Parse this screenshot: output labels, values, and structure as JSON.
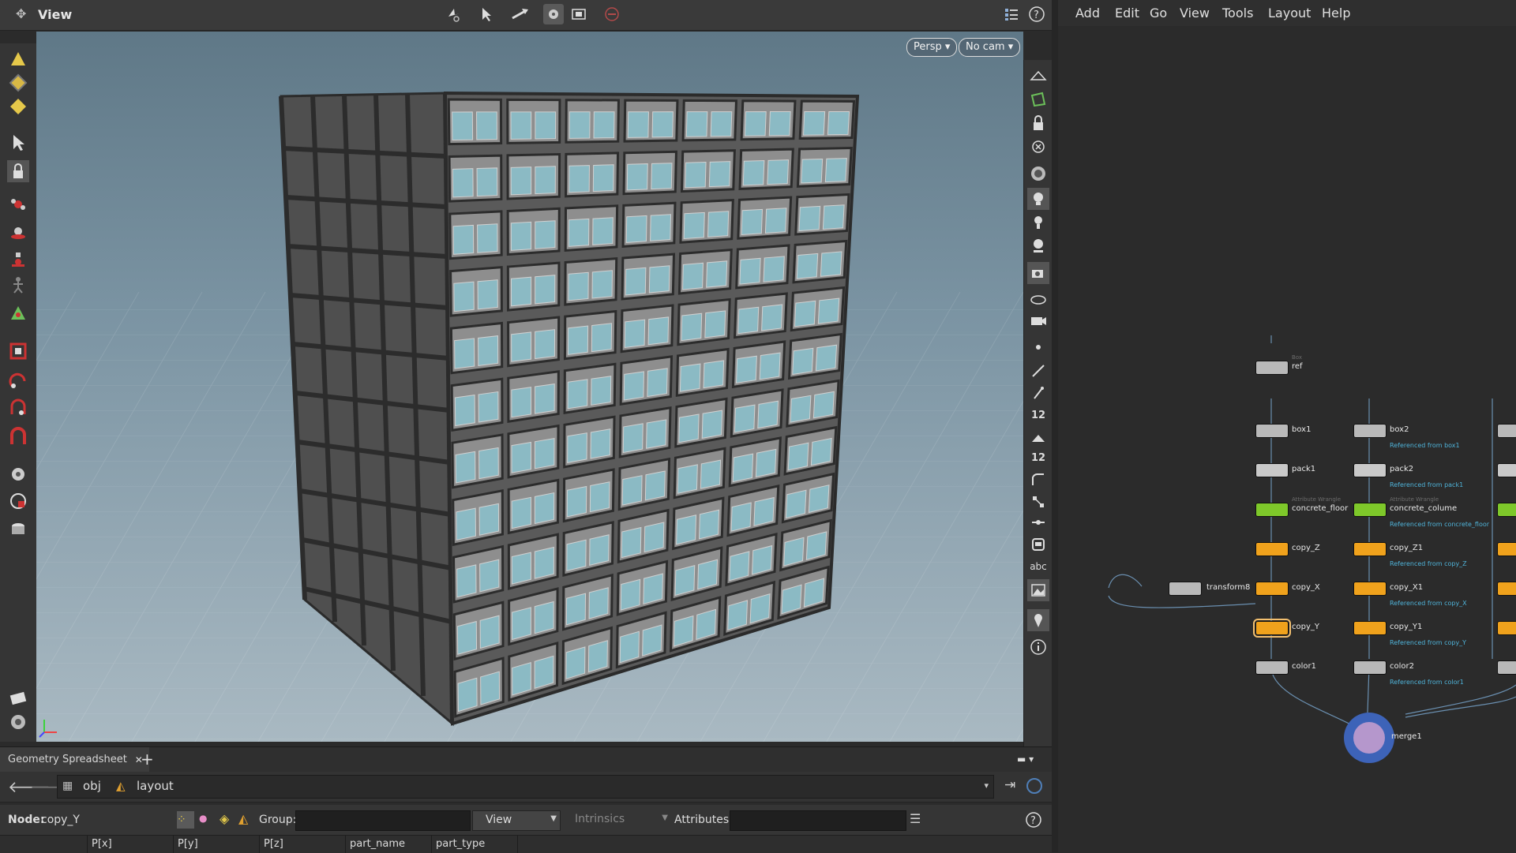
{
  "viewer": {
    "title": "View",
    "persp_label": "Persp",
    "camera_label": "No cam",
    "right_icons": {
      "count_label": "12",
      "count_label_2": "12",
      "abc_label": "abc"
    }
  },
  "spreadsheet": {
    "tab_label": "Geometry Spreadsheet",
    "path": {
      "obj": "obj",
      "layout": "layout"
    },
    "node_label": "Node:",
    "node_value": "copy_Y",
    "group_label": "Group:",
    "view_label": "View",
    "intrinsics_label": "Intrinsics",
    "attributes_label": "Attributes:",
    "columns": [
      "P[x]",
      "P[y]",
      "P[z]",
      "part_name",
      "part_type"
    ]
  },
  "network": {
    "menu": [
      "Add",
      "Edit",
      "Go",
      "View",
      "Tools",
      "Layout",
      "Help"
    ],
    "nodes": {
      "ref": {
        "type": "Box",
        "name": "ref"
      },
      "box1": {
        "name": "box1"
      },
      "box2": {
        "name": "box2",
        "ref": "Referenced from box1"
      },
      "pack1": {
        "name": "pack1"
      },
      "pack2": {
        "name": "pack2",
        "ref": "Referenced from pack1"
      },
      "floor": {
        "type": "Attribute Wrangle",
        "name": "concrete_floor"
      },
      "colume": {
        "type": "Attribute Wrangle",
        "name": "concrete_colume",
        "ref": "Referenced from concrete_floor"
      },
      "copy_z": {
        "name": "copy_Z"
      },
      "copy_z1": {
        "name": "copy_Z1",
        "ref": "Referenced from copy_Z"
      },
      "transform": {
        "name": "transform8"
      },
      "copy_x": {
        "name": "copy_X"
      },
      "copy_x1": {
        "name": "copy_X1",
        "ref": "Referenced from copy_X"
      },
      "copy_y": {
        "name": "copy_Y"
      },
      "copy_y1": {
        "name": "copy_Y1",
        "ref": "Referenced from copy_Y"
      },
      "color1": {
        "name": "color1"
      },
      "color2": {
        "name": "color2",
        "ref": "Referenced from color1"
      },
      "merge": {
        "name": "merge1"
      }
    }
  },
  "colors": {
    "node_gray": "#b9b9b9",
    "node_orange": "#f0a21c",
    "node_green": "#7ec82a",
    "ref_text": "#4fb3d9",
    "merge_blue": "#3d63b8"
  }
}
